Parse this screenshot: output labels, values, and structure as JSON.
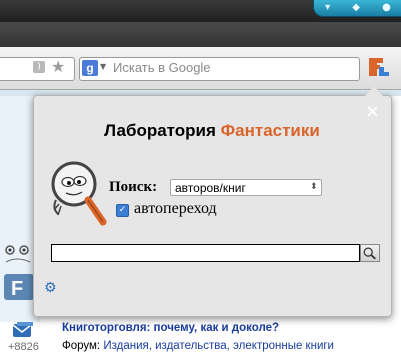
{
  "window": {
    "controls": [
      "▾",
      "◆",
      "●"
    ]
  },
  "toolbar": {
    "search_placeholder": "Искать в Google",
    "search_engine_letter": "g"
  },
  "page": {
    "count": "+8826",
    "news_title": "Книготорговля: почему, как и доколе?",
    "forum_label": "Форум:",
    "forum_link": "Издания, издательства, электронные книги"
  },
  "popup": {
    "brand_part1": "Лаборатория ",
    "brand_part2": "Фантастики",
    "search_label": "Поиск:",
    "search_type": "авторов/книг",
    "auto_label": "автопереход",
    "auto_checked": true,
    "query_value": "",
    "close_symbol": "✕",
    "settings_symbol": "⚙"
  },
  "colors": {
    "brand_accent": "#d9652a",
    "link": "#1a3d9b",
    "checkbox": "#3b7fd4"
  }
}
